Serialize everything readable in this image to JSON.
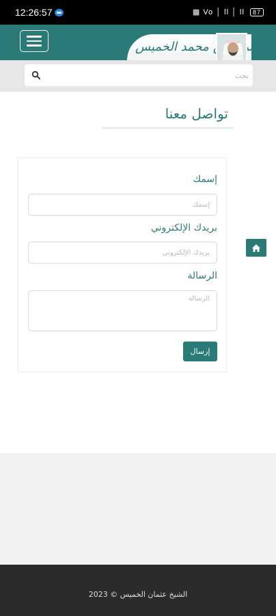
{
  "status_bar": {
    "time": "12:26:57",
    "indicators": "▦ Vo │ ll │ ll",
    "battery": "87"
  },
  "header": {
    "banner_text": "د.عثمان بن محمد الخميس",
    "menu_icon": "hamburger-icon",
    "accent_color": "#2a7a78"
  },
  "search": {
    "placeholder": "بحث",
    "value": ""
  },
  "page": {
    "title": "تواصل معنا"
  },
  "form": {
    "name_label": "إسمك",
    "name_placeholder": "إسمك",
    "email_label": "بريدك الإلكتروني",
    "email_placeholder": "بريدك الإلكتروني",
    "message_label": "الرسالة",
    "message_placeholder": "الرسالة",
    "submit_label": "إرسال"
  },
  "footer": {
    "copyright": "الشيخ عثمان الخميس © 2023"
  }
}
